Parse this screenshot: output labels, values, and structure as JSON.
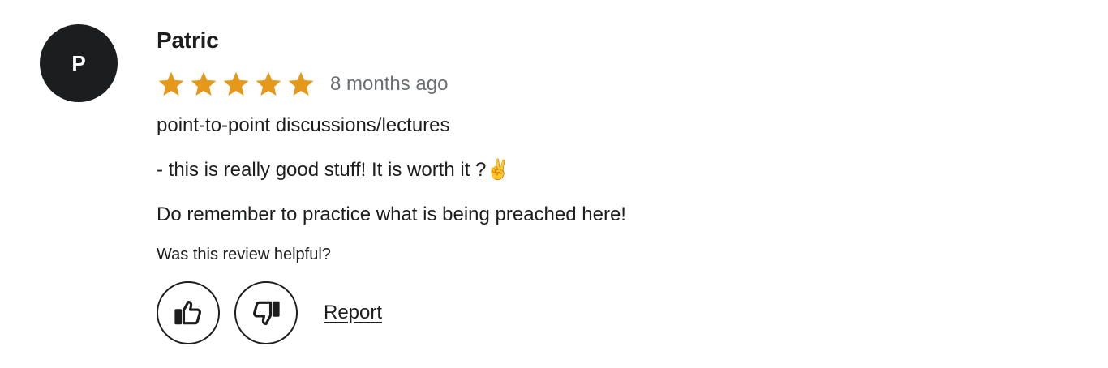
{
  "reviewer": {
    "initial": "P",
    "name": "Patric",
    "avatar_color": "#1c1d1f"
  },
  "rating": {
    "stars": 5,
    "max": 5,
    "star_color": "#e59819",
    "time_ago": "8 months ago"
  },
  "review": {
    "lines": [
      "point-to-point discussions/lectures",
      "- this is really good stuff! It is worth it ?✌️",
      "Do remember to practice what is being preached here!"
    ]
  },
  "feedback": {
    "prompt": "Was this review helpful?",
    "thumbs_up_icon": "thumbs-up-icon",
    "thumbs_down_icon": "thumbs-down-icon",
    "report_label": "Report"
  }
}
